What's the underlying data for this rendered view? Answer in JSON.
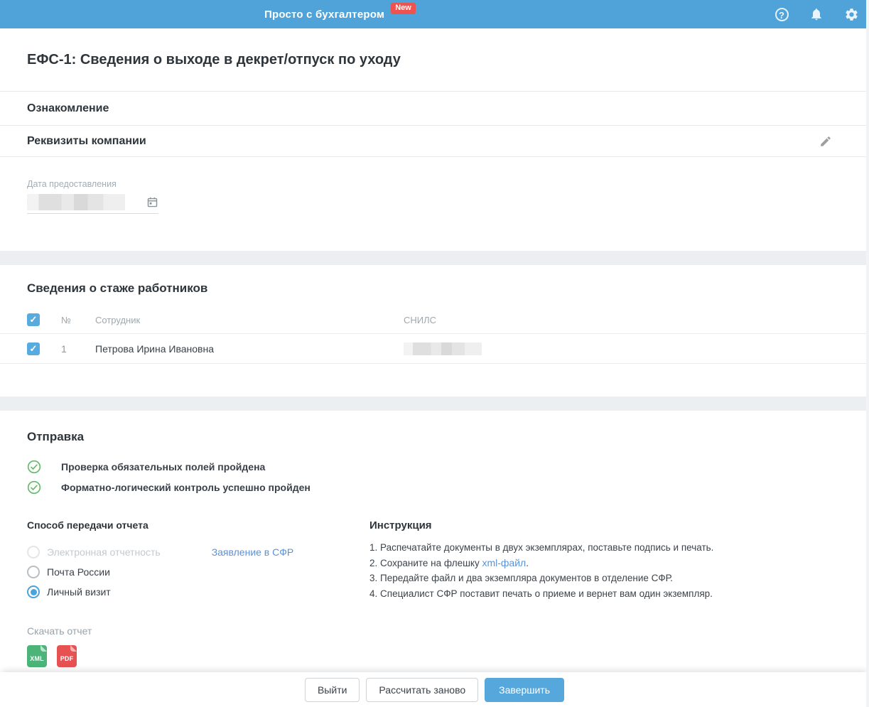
{
  "header": {
    "title": "Просто с бухгалтером",
    "badge": "New",
    "icons": {
      "help": "help-icon",
      "notifications": "bell-icon",
      "settings": "gear-icon"
    }
  },
  "page": {
    "title": "ЕФС-1: Сведения о выходе в декрет/отпуск по уходу"
  },
  "sections": {
    "familiarization": "Ознакомление",
    "company": "Реквизиты компании"
  },
  "company": {
    "date_label": "Дата предоставления",
    "date_value_redacted": true
  },
  "employees": {
    "title": "Сведения о стаже работников",
    "columns": {
      "num": "№",
      "employee": "Сотрудник",
      "snils": "СНИЛС"
    },
    "rows": [
      {
        "num": "1",
        "name": "Петрова Ирина Ивановна",
        "snils_redacted": true,
        "checked": true
      }
    ],
    "select_all_checked": true
  },
  "sending": {
    "title": "Отправка",
    "checks": [
      "Проверка обязательных полей пройдена",
      "Форматно-логический контроль успешно пройден"
    ],
    "method": {
      "label": "Способ передачи отчета",
      "options": [
        {
          "label": "Электронная отчетность",
          "state": "disabled",
          "link": "Заявление в СФР"
        },
        {
          "label": "Почта России",
          "state": "unchecked"
        },
        {
          "label": "Личный визит",
          "state": "checked"
        }
      ]
    },
    "instruction": {
      "title": "Инструкция",
      "steps": [
        {
          "text": "1. Распечатайте документы в двух экземплярах, поставьте подпись и печать."
        },
        {
          "prefix": "2. Сохраните на флешку ",
          "link": "xml-файл",
          "suffix": "."
        },
        {
          "text": "3. Передайте файл и два экземпляра документов в отделение СФР."
        },
        {
          "text": "4. Специалист СФР поставит печать о приеме и вернет вам один экземпляр."
        }
      ]
    },
    "download": {
      "label": "Скачать отчет",
      "files": [
        "XML",
        "PDF"
      ]
    }
  },
  "footer": {
    "exit": "Выйти",
    "recalculate": "Рассчитать заново",
    "finish": "Завершить"
  },
  "colors": {
    "header_blue": "#4fa3d9",
    "badge_red": "#ef5350",
    "accent_blue": "#55a7dc",
    "link_blue": "#5b92d6",
    "success_green": "#66bb6a",
    "xml_green": "#4cb478",
    "pdf_red": "#e65252",
    "band_gray": "#eceff1"
  }
}
